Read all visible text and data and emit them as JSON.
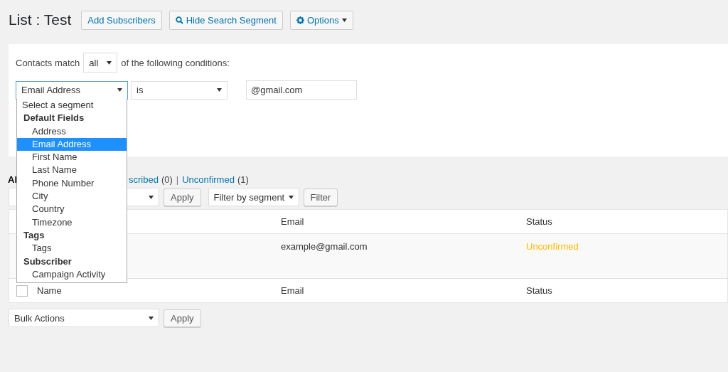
{
  "title": "List : Test",
  "header_buttons": [
    {
      "label": "Add Subscribers"
    },
    {
      "label": "Hide Search Segment"
    },
    {
      "label": "Options"
    }
  ],
  "segment": {
    "match_prefix": "Contacts match",
    "match_value": "all",
    "match_suffix": "of the following conditions:",
    "condition": {
      "field": "Email Address",
      "operator": "is",
      "value": "@gmail.com"
    }
  },
  "segment_dropdown": {
    "items": [
      {
        "kind": "option",
        "label": "Select a segment",
        "selected": false
      },
      {
        "kind": "group",
        "label": "Default Fields"
      },
      {
        "kind": "suboption",
        "label": "Address",
        "selected": false
      },
      {
        "kind": "suboption",
        "label": "Email Address",
        "selected": true
      },
      {
        "kind": "suboption",
        "label": "First Name",
        "selected": false
      },
      {
        "kind": "suboption",
        "label": "Last Name",
        "selected": false
      },
      {
        "kind": "suboption",
        "label": "Phone Number",
        "selected": false
      },
      {
        "kind": "suboption",
        "label": "City",
        "selected": false
      },
      {
        "kind": "suboption",
        "label": "Country",
        "selected": false
      },
      {
        "kind": "suboption",
        "label": "Timezone",
        "selected": false
      },
      {
        "kind": "group",
        "label": "Tags"
      },
      {
        "kind": "suboption",
        "label": "Tags",
        "selected": false
      },
      {
        "kind": "group",
        "label": "Subscriber"
      },
      {
        "kind": "suboption",
        "label": "Campaign Activity",
        "selected": false
      }
    ]
  },
  "views": [
    {
      "label": "Al",
      "selected": true
    },
    {
      "label": "scribed",
      "count": "(0)",
      "selected": false
    },
    {
      "label": "Unconfirmed",
      "count": "(1)",
      "separator": "|",
      "selected": false
    }
  ],
  "top_toolbar": {
    "apply": "Apply",
    "filter_select": "Filter by segment",
    "filter": "Filter"
  },
  "table": {
    "columns": [
      {
        "label": "Email"
      },
      {
        "label": "Status"
      }
    ],
    "rows": [
      {
        "email": "example@gmail.com",
        "status": "Unconfirmed",
        "color": "#ffb900"
      }
    ],
    "footer_checked": false,
    "footer_columns": [
      {
        "label": "Name"
      },
      {
        "label": "Email"
      },
      {
        "label": "Status"
      }
    ]
  },
  "bottom_toolbar": {
    "bulk": "Bulk Actions",
    "apply": "Apply"
  }
}
